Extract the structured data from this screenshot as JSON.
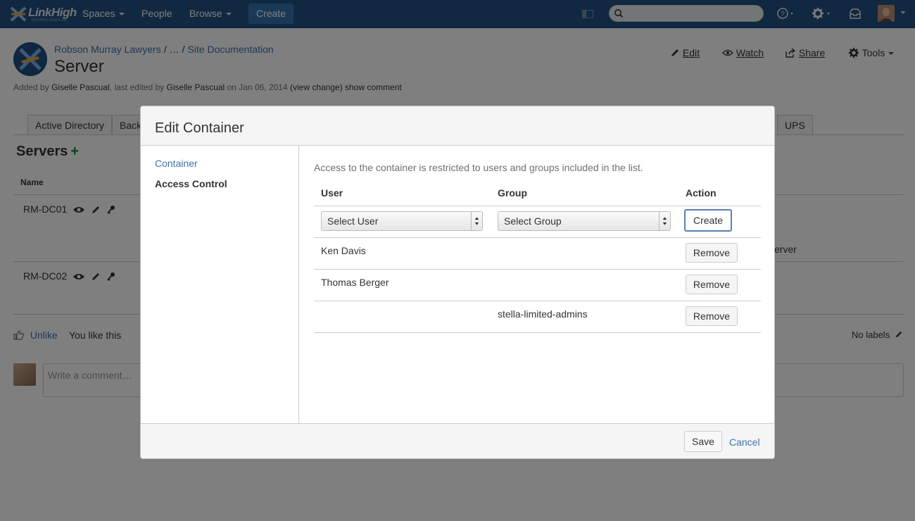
{
  "nav": {
    "logo_text": "LinkHigh",
    "logo_sub": "TECHNOLOGIES INC",
    "spaces": "Spaces",
    "people": "People",
    "browse": "Browse",
    "create": "Create"
  },
  "page": {
    "breadcrumb": [
      "Robson Murray Lawyers",
      "…",
      "Site Documentation"
    ],
    "title": "Server",
    "byline": {
      "added_by": "Added by",
      "author": "Giselle Pascual",
      "last_edited": ", last edited by",
      "editor": "Giselle Pascual",
      "on_date": "on Jan 06, 2014",
      "view_change": "(view change)",
      "show_comment": "show comment"
    },
    "actions": {
      "edit": "Edit",
      "watch": "Watch",
      "share": "Share",
      "tools": "Tools"
    },
    "tabs": [
      "Active Directory",
      "Back",
      "UPS"
    ],
    "section_title": "Servers",
    "col_name": "Name",
    "servers": [
      "RM-DC01",
      "RM-DC02"
    ],
    "server_fragment": "erver",
    "unlike": "Unlike",
    "you_like": "You like this",
    "no_labels": "No labels",
    "comment_placeholder": "Write a comment…"
  },
  "dialog": {
    "title": "Edit Container",
    "menu": {
      "container": "Container",
      "access_control": "Access Control"
    },
    "description": "Access to the container is restricted to users and groups included in the list.",
    "headers": {
      "user": "User",
      "group": "Group",
      "action": "Action"
    },
    "select_user": "Select User",
    "select_group": "Select Group",
    "create_button": "Create",
    "remove_label": "Remove",
    "entries": [
      {
        "user": "Ken Davis",
        "group": ""
      },
      {
        "user": "Thomas Berger",
        "group": ""
      },
      {
        "user": "",
        "group": "stella-limited-admins"
      }
    ],
    "save": "Save",
    "cancel": "Cancel"
  },
  "colors": {
    "nav_bg": "#205081",
    "link": "#3b73af",
    "add_green": "#14892c"
  }
}
